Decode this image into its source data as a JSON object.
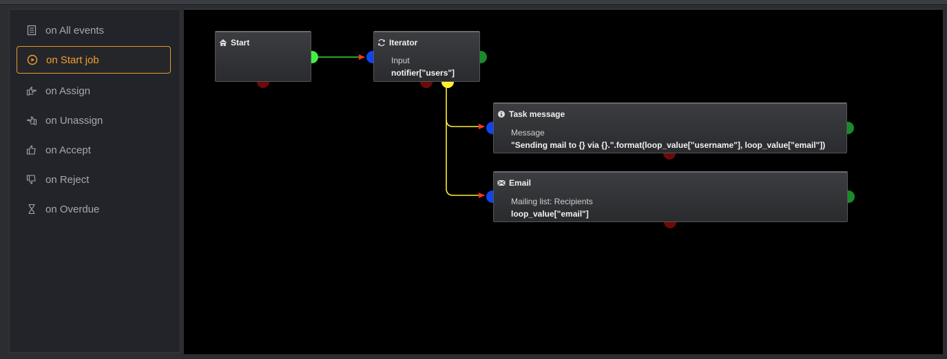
{
  "sidebar": {
    "items": [
      {
        "label": "on All events",
        "icon": "list-icon"
      },
      {
        "label": "on Start job",
        "icon": "play-circle-icon",
        "active": true
      },
      {
        "label": "on Assign",
        "icon": "hand-point-right-icon"
      },
      {
        "label": "on Unassign",
        "icon": "hand-point-left-icon"
      },
      {
        "label": "on Accept",
        "icon": "thumbs-up-icon"
      },
      {
        "label": "on Reject",
        "icon": "thumbs-down-icon"
      },
      {
        "label": "on Overdue",
        "icon": "hourglass-icon"
      }
    ]
  },
  "nodes": {
    "start": {
      "title": "Start",
      "icon": "home-icon"
    },
    "iterator": {
      "title": "Iterator",
      "icon": "refresh-icon",
      "label": "Input",
      "value": "notifier[\"users\"]"
    },
    "task_message": {
      "title": "Task message",
      "icon": "info-circle-icon",
      "label": "Message",
      "value": "\"Sending mail to {} via {}.\".format(loop_value[\"username\"], loop_value[\"email\"])"
    },
    "email": {
      "title": "Email",
      "icon": "envelope-icon",
      "label": "Mailing list: Recipients",
      "value": "loop_value[\"email\"]"
    }
  },
  "colors": {
    "accent": "#f0a030",
    "wire_green": "#33dd33",
    "wire_yellow": "#ffee33",
    "arrow_red": "#ff3322",
    "port_blue": "#1144ee",
    "port_green": "#1a8a2a",
    "port_dark_red": "#6a0a0a",
    "port_yellow": "#ffee33",
    "port_bright_green": "#44ee44"
  }
}
